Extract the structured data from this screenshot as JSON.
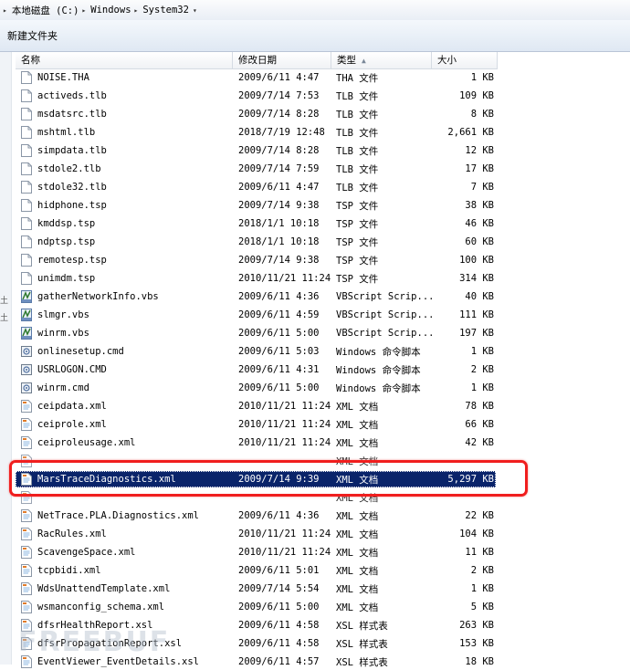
{
  "address": {
    "crumbs": [
      "本地磁盘 (C:)",
      "Windows",
      "System32"
    ]
  },
  "toolbar": {
    "new_folder_label": "新建文件夹"
  },
  "columns": {
    "name": "名称",
    "date": "修改日期",
    "type": "类型",
    "size": "大小",
    "sorted_by": "type"
  },
  "left_marks": [
    "土",
    "土"
  ],
  "files": [
    {
      "name": "NOISE.THA",
      "date": "2009/6/11 4:47",
      "type": "THA 文件",
      "size": "1 KB",
      "icon": "file-icon"
    },
    {
      "name": "activeds.tlb",
      "date": "2009/7/14 7:53",
      "type": "TLB 文件",
      "size": "109 KB",
      "icon": "file-icon"
    },
    {
      "name": "msdatsrc.tlb",
      "date": "2009/7/14 8:28",
      "type": "TLB 文件",
      "size": "8 KB",
      "icon": "file-icon"
    },
    {
      "name": "mshtml.tlb",
      "date": "2018/7/19 12:48",
      "type": "TLB 文件",
      "size": "2,661 KB",
      "icon": "file-icon"
    },
    {
      "name": "simpdata.tlb",
      "date": "2009/7/14 8:28",
      "type": "TLB 文件",
      "size": "12 KB",
      "icon": "file-icon"
    },
    {
      "name": "stdole2.tlb",
      "date": "2009/7/14 7:59",
      "type": "TLB 文件",
      "size": "17 KB",
      "icon": "file-icon"
    },
    {
      "name": "stdole32.tlb",
      "date": "2009/6/11 4:47",
      "type": "TLB 文件",
      "size": "7 KB",
      "icon": "file-icon"
    },
    {
      "name": "hidphone.tsp",
      "date": "2009/7/14 9:38",
      "type": "TSP 文件",
      "size": "38 KB",
      "icon": "file-icon"
    },
    {
      "name": "kmddsp.tsp",
      "date": "2018/1/1 10:18",
      "type": "TSP 文件",
      "size": "46 KB",
      "icon": "file-icon"
    },
    {
      "name": "ndptsp.tsp",
      "date": "2018/1/1 10:18",
      "type": "TSP 文件",
      "size": "60 KB",
      "icon": "file-icon"
    },
    {
      "name": "remotesp.tsp",
      "date": "2009/7/14 9:38",
      "type": "TSP 文件",
      "size": "100 KB",
      "icon": "file-icon"
    },
    {
      "name": "unimdm.tsp",
      "date": "2010/11/21 11:24",
      "type": "TSP 文件",
      "size": "314 KB",
      "icon": "file-icon"
    },
    {
      "name": "gatherNetworkInfo.vbs",
      "date": "2009/6/11 4:36",
      "type": "VBScript Scrip...",
      "size": "40 KB",
      "icon": "vbscript-icon"
    },
    {
      "name": "slmgr.vbs",
      "date": "2009/6/11 4:59",
      "type": "VBScript Scrip...",
      "size": "111 KB",
      "icon": "vbscript-icon"
    },
    {
      "name": "winrm.vbs",
      "date": "2009/6/11 5:00",
      "type": "VBScript Scrip...",
      "size": "197 KB",
      "icon": "vbscript-icon"
    },
    {
      "name": "onlinesetup.cmd",
      "date": "2009/6/11 5:03",
      "type": "Windows 命令脚本",
      "size": "1 KB",
      "icon": "cmd-icon"
    },
    {
      "name": "USRLOGON.CMD",
      "date": "2009/6/11 4:31",
      "type": "Windows 命令脚本",
      "size": "2 KB",
      "icon": "cmd-icon"
    },
    {
      "name": "winrm.cmd",
      "date": "2009/6/11 5:00",
      "type": "Windows 命令脚本",
      "size": "1 KB",
      "icon": "cmd-icon"
    },
    {
      "name": "ceipdata.xml",
      "date": "2010/11/21 11:24",
      "type": "XML 文档",
      "size": "78 KB",
      "icon": "xml-icon"
    },
    {
      "name": "ceiprole.xml",
      "date": "2010/11/21 11:24",
      "type": "XML 文档",
      "size": "66 KB",
      "icon": "xml-icon"
    },
    {
      "name": "ceiproleusage.xml",
      "date": "2010/11/21 11:24",
      "type": "XML 文档",
      "size": "42 KB",
      "icon": "xml-icon"
    },
    {
      "name": "",
      "date": "",
      "type": "XML 文档",
      "size": "",
      "icon": "xml-icon",
      "partial": true
    },
    {
      "name": "MarsTraceDiagnostics.xml",
      "date": "2009/7/14 9:39",
      "type": "XML 文档",
      "size": "5,297 KB",
      "icon": "xml-icon",
      "selected": true
    },
    {
      "name": "",
      "date": "",
      "type": "XML 文档",
      "size": "",
      "icon": "xml-icon",
      "partial": true
    },
    {
      "name": "NetTrace.PLA.Diagnostics.xml",
      "date": "2009/6/11 4:36",
      "type": "XML 文档",
      "size": "22 KB",
      "icon": "xml-icon"
    },
    {
      "name": "RacRules.xml",
      "date": "2010/11/21 11:24",
      "type": "XML 文档",
      "size": "104 KB",
      "icon": "xml-icon"
    },
    {
      "name": "ScavengeSpace.xml",
      "date": "2010/11/21 11:24",
      "type": "XML 文档",
      "size": "11 KB",
      "icon": "xml-icon"
    },
    {
      "name": "tcpbidi.xml",
      "date": "2009/6/11 5:01",
      "type": "XML 文档",
      "size": "2 KB",
      "icon": "xml-icon"
    },
    {
      "name": "WdsUnattendTemplate.xml",
      "date": "2009/7/14 5:54",
      "type": "XML 文档",
      "size": "1 KB",
      "icon": "xml-icon"
    },
    {
      "name": "wsmanconfig_schema.xml",
      "date": "2009/6/11 5:00",
      "type": "XML 文档",
      "size": "5 KB",
      "icon": "xml-icon"
    },
    {
      "name": "dfsrHealthReport.xsl",
      "date": "2009/6/11 4:58",
      "type": "XSL 样式表",
      "size": "263 KB",
      "icon": "xsl-icon"
    },
    {
      "name": "dfsrPropagationReport.xsl",
      "date": "2009/6/11 4:58",
      "type": "XSL 样式表",
      "size": "153 KB",
      "icon": "xsl-icon"
    },
    {
      "name": "EventViewer_EventDetails.xsl",
      "date": "2009/6/11 4:57",
      "type": "XSL 样式表",
      "size": "18 KB",
      "icon": "xsl-icon"
    }
  ],
  "watermark": "FREEBUF",
  "colors": {
    "selection": "#0a246a",
    "highlight": "#f01e1e"
  }
}
